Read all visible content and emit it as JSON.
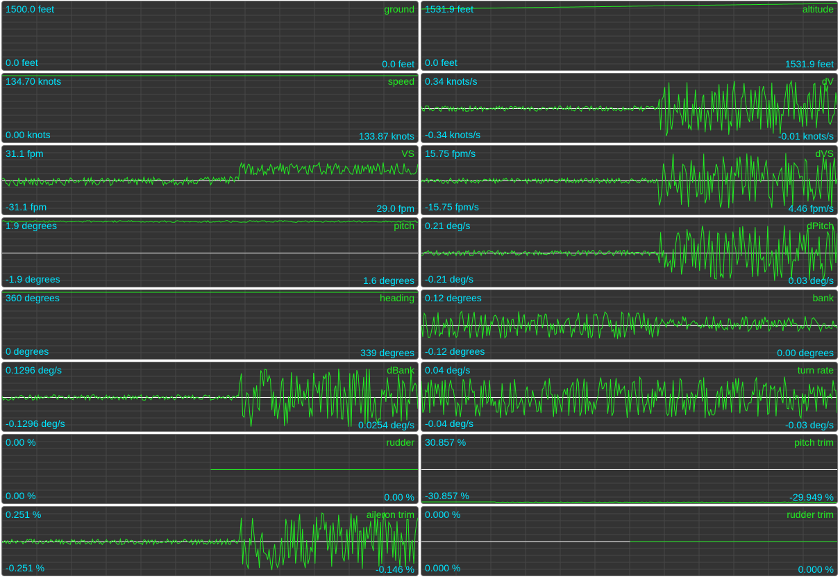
{
  "colors": {
    "panel_bg": "#333333",
    "grid": "#474747",
    "trace": "#22ee22",
    "zero_line": "#ffffff",
    "value_text": "#00e5ff",
    "title_text": "#22ee22"
  },
  "panels": [
    {
      "title": "ground",
      "max": "1500.0 feet",
      "min": "0.0 feet",
      "current": "0.0 feet",
      "zero_line": false,
      "trace": "none"
    },
    {
      "title": "altitude",
      "max": "1531.9 feet",
      "min": "0.0 feet",
      "current": "1531.9 feet",
      "zero_line": false,
      "trace": "top-ramp"
    },
    {
      "title": "speed",
      "max": "134.70 knots",
      "min": "0.00 knots",
      "current": "133.87 knots",
      "zero_line": false,
      "trace": "top-flat"
    },
    {
      "title": "dV",
      "max": "0.34 knots/s",
      "min": "-0.34 knots/s",
      "current": "-0.01 knots/s",
      "zero_line": true,
      "trace": "noise-late"
    },
    {
      "title": "VS",
      "max": "31.1 fpm",
      "min": "-31.1 fpm",
      "current": "29.0 fpm",
      "zero_line": true,
      "trace": "step-up"
    },
    {
      "title": "dVS",
      "max": "15.75 fpm/s",
      "min": "-15.75 fpm/s",
      "current": "4.46 fpm/s",
      "zero_line": true,
      "trace": "noise-late"
    },
    {
      "title": "pitch",
      "max": "1.9 degrees",
      "min": "-1.9 degrees",
      "current": "1.6 degrees",
      "zero_line": true,
      "trace": "top-wobble"
    },
    {
      "title": "dPitch",
      "max": "0.21 deg/s",
      "min": "-0.21 deg/s",
      "current": "0.03 deg/s",
      "zero_line": true,
      "trace": "noise-late"
    },
    {
      "title": "heading",
      "max": "360 degrees",
      "min": "0 degrees",
      "current": "339 degrees",
      "zero_line": false,
      "trace": "top-flat"
    },
    {
      "title": "bank",
      "max": "0.12 degrees",
      "min": "-0.12 degrees",
      "current": "0.00 degrees",
      "zero_line": true,
      "trace": "noise-bank"
    },
    {
      "title": "dBank",
      "max": "0.1296 deg/s",
      "min": "-0.1296 deg/s",
      "current": "0.0254 deg/s",
      "zero_line": true,
      "trace": "noise-mid"
    },
    {
      "title": "turn rate",
      "max": "0.04 deg/s",
      "min": "-0.04 deg/s",
      "current": "-0.03 deg/s",
      "zero_line": true,
      "trace": "noise-full"
    },
    {
      "title": "rudder",
      "max": "0.00 %",
      "min": "0.00 %",
      "current": "0.00 %",
      "zero_line": false,
      "trace": "half-flat"
    },
    {
      "title": "pitch trim",
      "max": "30.857 %",
      "min": "-30.857 %",
      "current": "-29.949 %",
      "zero_line": true,
      "trace": "bottom-flat"
    },
    {
      "title": "aileron trim",
      "max": "0.251 %",
      "min": "-0.251 %",
      "current": "-0.146 %",
      "zero_line": true,
      "trace": "noise-mid"
    },
    {
      "title": "rudder trim",
      "max": "0.000 %",
      "min": "0.000 %",
      "current": "0.000 %",
      "zero_line": true,
      "trace": "half-flat"
    }
  ]
}
